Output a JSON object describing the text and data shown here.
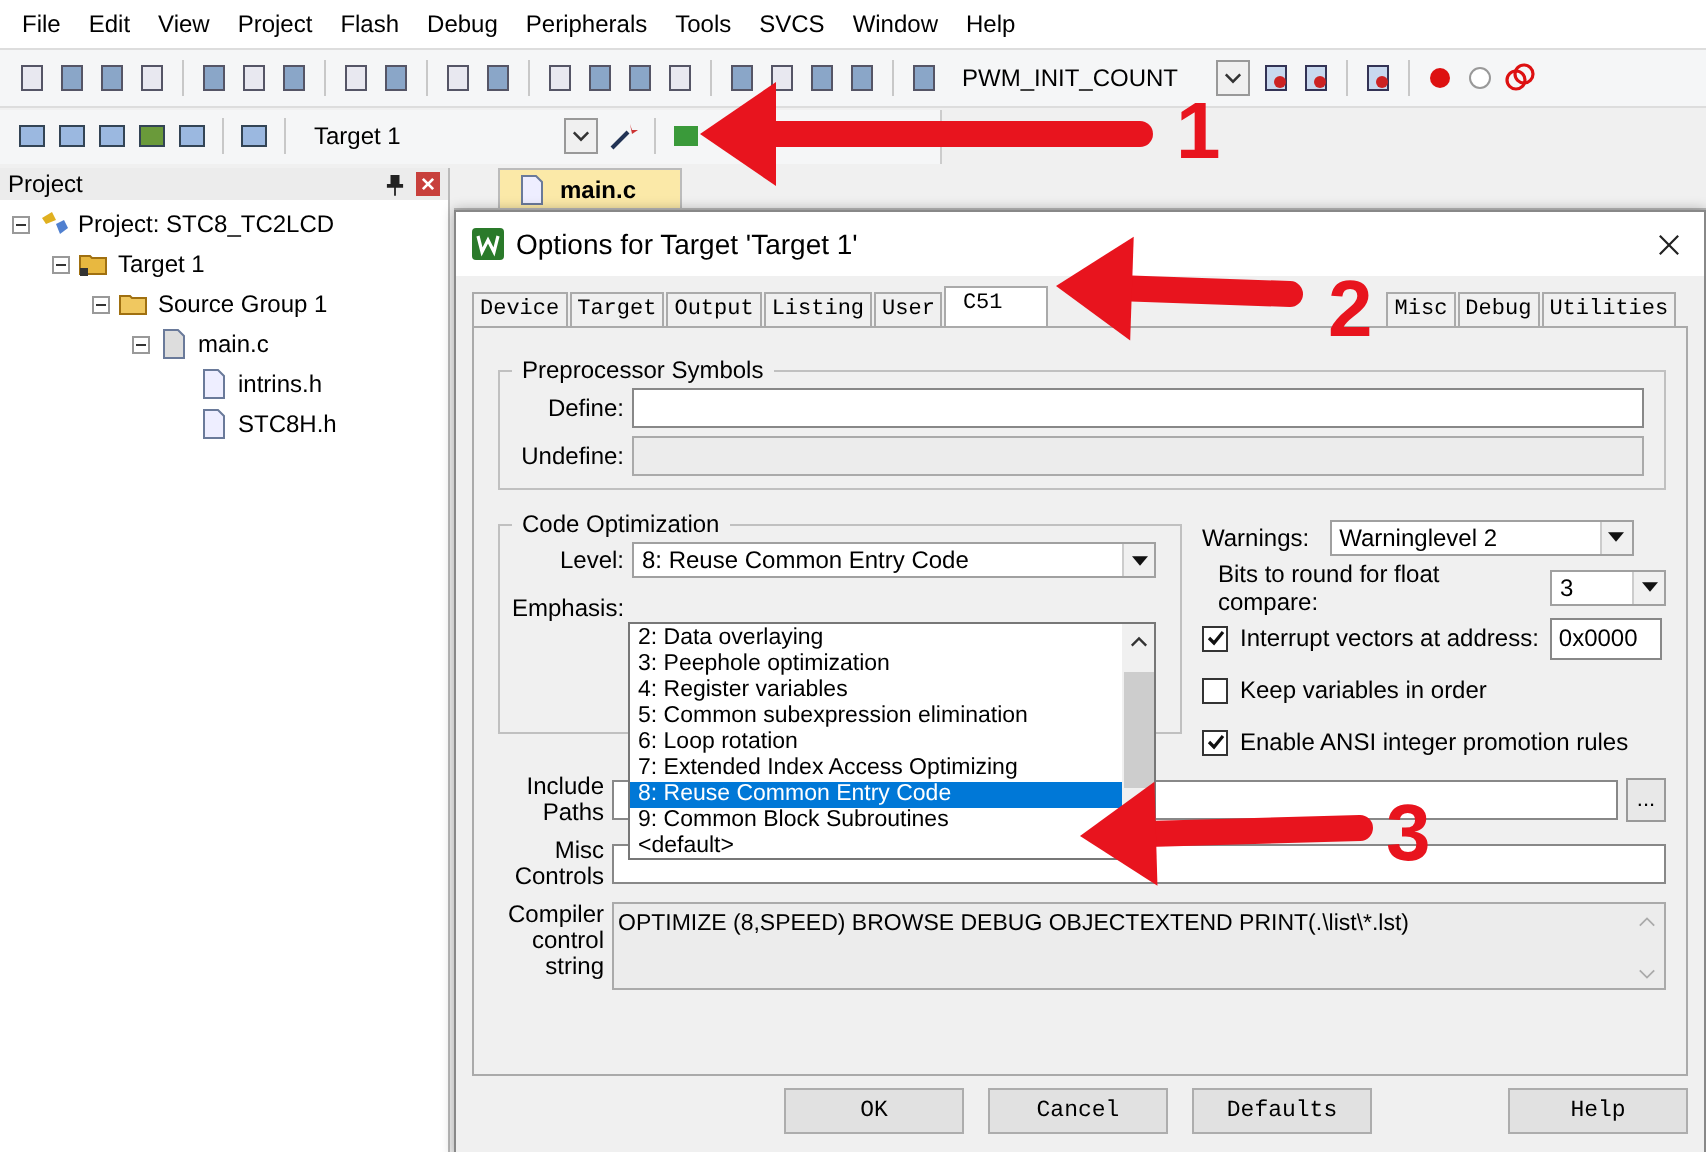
{
  "menu": [
    "File",
    "Edit",
    "View",
    "Project",
    "Flash",
    "Debug",
    "Peripherals",
    "Tools",
    "SVCS",
    "Window",
    "Help"
  ],
  "toolbar": {
    "symbol_field": "PWM_INIT_COUNT",
    "target_select": "Target 1"
  },
  "project_panel": {
    "title": "Project",
    "tree": [
      {
        "kind": "project",
        "label": "Project: STC8_TC2LCD",
        "expanded": true,
        "children": [
          {
            "kind": "target",
            "label": "Target 1",
            "expanded": true,
            "children": [
              {
                "kind": "group",
                "label": "Source Group 1",
                "expanded": true,
                "children": [
                  {
                    "kind": "source",
                    "label": "main.c",
                    "expanded": true,
                    "children": [
                      {
                        "kind": "header",
                        "label": "intrins.h"
                      },
                      {
                        "kind": "header",
                        "label": "STC8H.h"
                      }
                    ]
                  }
                ]
              }
            ]
          }
        ]
      }
    ]
  },
  "editor_tabs": [
    {
      "label": "main.c",
      "selected": true
    }
  ],
  "dialog": {
    "title": "Options for Target 'Target 1'",
    "tabs": [
      {
        "label": "Device",
        "selected": false
      },
      {
        "label": "Target",
        "selected": false
      },
      {
        "label": "Output",
        "selected": false
      },
      {
        "label": "Listing",
        "selected": false
      },
      {
        "label": "User",
        "selected": false
      },
      {
        "label": "C51",
        "selected": true
      },
      {
        "label": "Misc",
        "selected": false
      },
      {
        "label": "Debug",
        "selected": false
      },
      {
        "label": "Utilities",
        "selected": false
      }
    ],
    "preprocessor": {
      "title": "Preprocessor Symbols",
      "define": {
        "label": "Define:",
        "disabled": false
      },
      "undefine": {
        "label": "Undefine:",
        "disabled": true
      }
    },
    "code_optimization": {
      "title": "Code Optimization",
      "level_label": "Level:",
      "level_value": "8: Reuse Common Entry Code",
      "emphasis_label": "Emphasis:",
      "dropdown": [
        {
          "label": "2: Data overlaying",
          "selected": false
        },
        {
          "label": "3: Peephole optimization",
          "selected": false
        },
        {
          "label": "4: Register variables",
          "selected": false
        },
        {
          "label": "5: Common subexpression elimination",
          "selected": false
        },
        {
          "label": "6: Loop rotation",
          "selected": false
        },
        {
          "label": "7: Extended Index Access Optimizing",
          "selected": false
        },
        {
          "label": "8: Reuse Common Entry Code",
          "selected": true
        },
        {
          "label": "9: Common Block Subroutines",
          "selected": false
        },
        {
          "label": "<default>",
          "selected": false
        }
      ]
    },
    "warnings": {
      "label": "Warnings:",
      "value": "Warninglevel 2"
    },
    "float_bits": {
      "label": "Bits to round for float compare:",
      "value": "3"
    },
    "options": [
      {
        "label": "Interrupt vectors at address:",
        "checked": true,
        "value": "0x0000"
      },
      {
        "label": "Keep variables in order",
        "checked": false
      },
      {
        "label": "Enable ANSI integer promotion rules",
        "checked": true
      }
    ],
    "include_paths": {
      "label": "Include Paths",
      "browse": "..."
    },
    "misc_controls": {
      "label": "Misc Controls"
    },
    "compiler_string": {
      "label": "Compiler control string",
      "value": "OPTIMIZE (8,SPEED) BROWSE DEBUG OBJECTEXTEND PRINT(.\\list\\*.lst)",
      "disabled": true
    },
    "buttons": [
      "OK",
      "Cancel",
      "Defaults",
      "Help"
    ]
  },
  "annotations": [
    {
      "label": "1"
    },
    {
      "label": "2"
    },
    {
      "label": "3"
    }
  ]
}
